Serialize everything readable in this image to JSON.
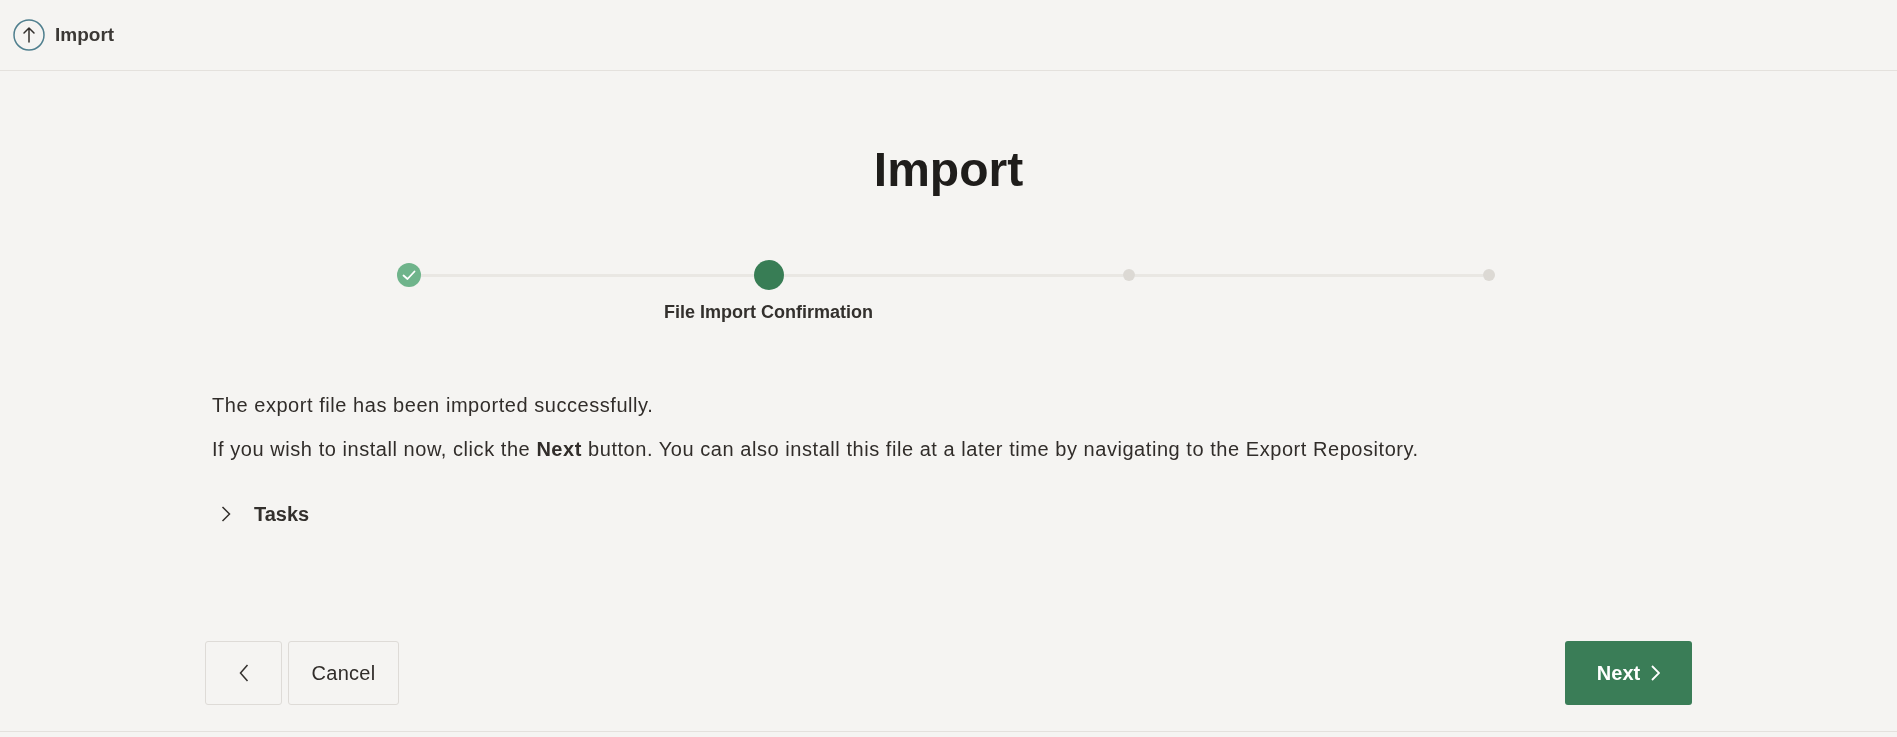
{
  "header": {
    "title": "Import"
  },
  "page": {
    "title": "Import"
  },
  "steps": [
    {
      "completed": true,
      "selected": false
    },
    {
      "completed": false,
      "selected": true,
      "label": "File Import Confirmation"
    },
    {
      "completed": false,
      "selected": false
    },
    {
      "completed": false,
      "selected": false
    }
  ],
  "messages": [
    "The export file has been imported successfully.",
    "If you wish to install now, click the **Next** button. You can also install this file at a later time by navigating to the Export Repository."
  ],
  "tasks": {
    "label": "Tasks",
    "expanded": false
  },
  "buttons": [
    {
      "kind": "back"
    },
    {
      "kind": "secondary",
      "label": "Cancel"
    },
    {
      "kind": "primary",
      "label": "Next"
    }
  ]
}
